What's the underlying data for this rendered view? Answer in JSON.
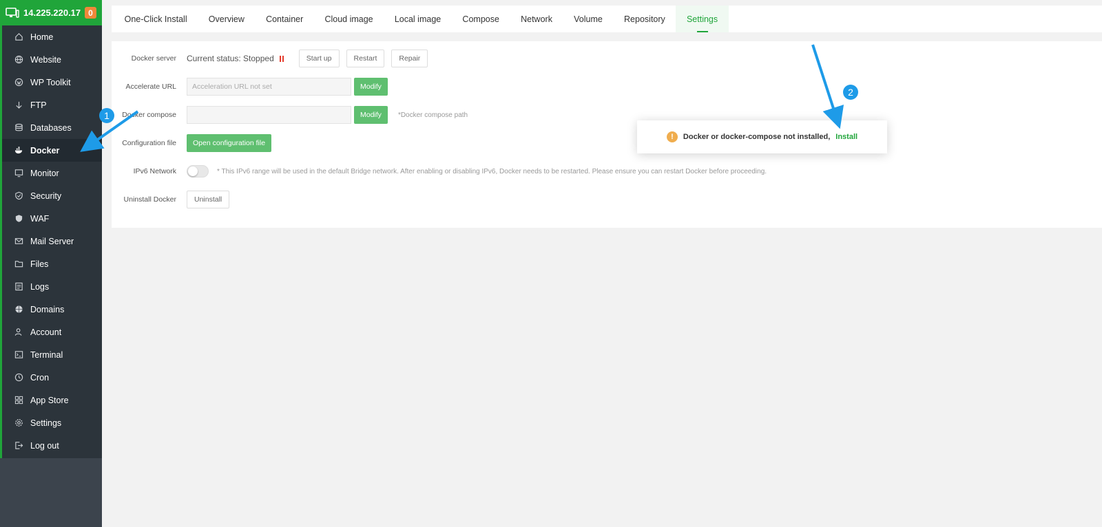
{
  "server": {
    "ip": "14.225.220.17",
    "badge": "0"
  },
  "sidebar": {
    "items": [
      {
        "label": "Home",
        "icon": "home-icon"
      },
      {
        "label": "Website",
        "icon": "globe-icon"
      },
      {
        "label": "WP Toolkit",
        "icon": "wordpress-icon"
      },
      {
        "label": "FTP",
        "icon": "ftp-icon"
      },
      {
        "label": "Databases",
        "icon": "database-icon"
      },
      {
        "label": "Docker",
        "icon": "docker-icon",
        "active": true
      },
      {
        "label": "Monitor",
        "icon": "monitor-icon"
      },
      {
        "label": "Security",
        "icon": "shield-icon"
      },
      {
        "label": "WAF",
        "icon": "waf-icon"
      },
      {
        "label": "Mail Server",
        "icon": "mail-icon"
      },
      {
        "label": "Files",
        "icon": "folder-icon"
      },
      {
        "label": "Logs",
        "icon": "logs-icon"
      },
      {
        "label": "Domains",
        "icon": "domain-icon"
      },
      {
        "label": "Account",
        "icon": "user-icon"
      },
      {
        "label": "Terminal",
        "icon": "terminal-icon"
      },
      {
        "label": "Cron",
        "icon": "clock-icon"
      },
      {
        "label": "App Store",
        "icon": "apps-icon"
      },
      {
        "label": "Settings",
        "icon": "gear-icon"
      },
      {
        "label": "Log out",
        "icon": "logout-icon"
      }
    ]
  },
  "tabs": [
    "One-Click Install",
    "Overview",
    "Container",
    "Cloud image",
    "Local image",
    "Compose",
    "Network",
    "Volume",
    "Repository",
    "Settings"
  ],
  "active_tab": "Settings",
  "settings": {
    "docker_server": {
      "label": "Docker server",
      "status": "Current status: Stopped",
      "start_label": "Start up",
      "restart_label": "Restart",
      "repair_label": "Repair"
    },
    "accelerate_url": {
      "label": "Accelerate URL",
      "placeholder": "Acceleration URL not set",
      "modify_label": "Modify"
    },
    "docker_compose": {
      "label": "Docker compose",
      "value": "",
      "modify_label": "Modify",
      "hint": "*Docker compose path"
    },
    "config_file": {
      "label": "Configuration file",
      "button_label": "Open configuration file"
    },
    "ipv6": {
      "label": "IPv6 Network",
      "enabled": false,
      "hint": "* This IPv6 range will be used in the default Bridge network. After enabling or disabling IPv6, Docker needs to be restarted. Please ensure you can restart Docker before proceeding."
    },
    "uninstall": {
      "label": "Uninstall Docker",
      "button_label": "Uninstall"
    }
  },
  "popup": {
    "message": "Docker or docker-compose not installed,",
    "action_label": "Install"
  },
  "annotations": {
    "step1": "1",
    "step2": "2"
  },
  "colors": {
    "accent": "#20a53a",
    "annotation": "#1e9be8",
    "warning": "#f0ad4e",
    "stopped": "#e43b2c"
  }
}
